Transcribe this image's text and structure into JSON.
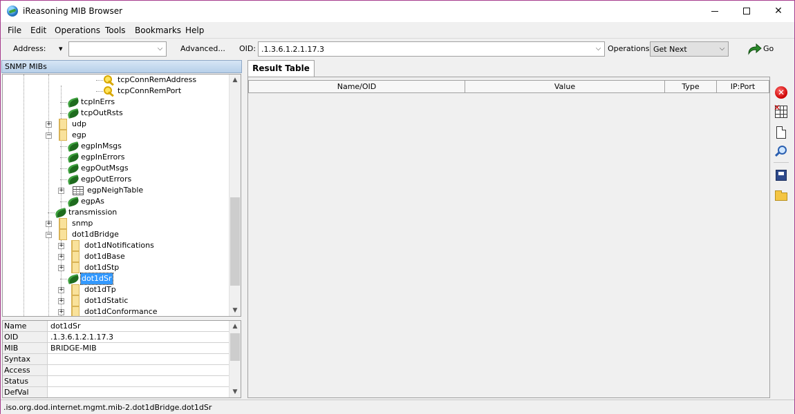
{
  "window": {
    "title": "iReasoning MIB Browser"
  },
  "menu": [
    "File",
    "Edit",
    "Operations",
    "Tools",
    "Bookmarks",
    "Help"
  ],
  "toolbar": {
    "address_label": "Address:",
    "address_value": "",
    "advanced_label": "Advanced...",
    "oid_label": "OID:",
    "oid_value": ".1.3.6.1.2.1.17.3",
    "operations_label": "Operations:",
    "operations_value": "Get Next",
    "go_label": "Go"
  },
  "tree": {
    "header": "SNMP MIBs",
    "items": [
      {
        "label": "tcpConnRemAddress",
        "icon": "key-icon",
        "depth": 4,
        "expander": false
      },
      {
        "label": "tcpConnRemPort",
        "icon": "key-icon",
        "depth": 4,
        "expander": false
      },
      {
        "label": "tcpInErrs",
        "icon": "leaf-icon",
        "depth": 2,
        "expander": false
      },
      {
        "label": "tcpOutRsts",
        "icon": "leaf-icon",
        "depth": 2,
        "expander": false
      },
      {
        "label": "udp",
        "icon": "folder-icon",
        "depth": 1,
        "expander": "plus"
      },
      {
        "label": "egp",
        "icon": "folder-icon",
        "depth": 1,
        "expander": "minus"
      },
      {
        "label": "egpInMsgs",
        "icon": "leaf-icon",
        "depth": 2,
        "expander": false
      },
      {
        "label": "egpInErrors",
        "icon": "leaf-icon",
        "depth": 2,
        "expander": false
      },
      {
        "label": "egpOutMsgs",
        "icon": "leaf-icon",
        "depth": 2,
        "expander": false
      },
      {
        "label": "egpOutErrors",
        "icon": "leaf-icon",
        "depth": 2,
        "expander": false
      },
      {
        "label": "egpNeighTable",
        "icon": "table-icon",
        "depth": 2,
        "expander": "plus"
      },
      {
        "label": "egpAs",
        "icon": "leaf-icon",
        "depth": 2,
        "expander": false
      },
      {
        "label": "transmission",
        "icon": "leaf-icon",
        "depth": 1,
        "expander": false
      },
      {
        "label": "snmp",
        "icon": "folder-icon",
        "depth": 1,
        "expander": "plus"
      },
      {
        "label": "dot1dBridge",
        "icon": "folder-icon",
        "depth": 1,
        "expander": "minus"
      },
      {
        "label": "dot1dNotifications",
        "icon": "folder-icon",
        "depth": 2,
        "expander": "plus"
      },
      {
        "label": "dot1dBase",
        "icon": "folder-icon",
        "depth": 2,
        "expander": "plus"
      },
      {
        "label": "dot1dStp",
        "icon": "folder-icon",
        "depth": 2,
        "expander": "plus"
      },
      {
        "label": "dot1dSr",
        "icon": "leaf-icon",
        "depth": 2,
        "expander": false,
        "selected": true
      },
      {
        "label": "dot1dTp",
        "icon": "folder-icon",
        "depth": 2,
        "expander": "plus"
      },
      {
        "label": "dot1dStatic",
        "icon": "folder-icon",
        "depth": 2,
        "expander": "plus"
      },
      {
        "label": "dot1dConformance",
        "icon": "folder-icon",
        "depth": 2,
        "expander": "plus"
      }
    ]
  },
  "properties": [
    {
      "key": "Name",
      "value": "dot1dSr"
    },
    {
      "key": "OID",
      "value": ".1.3.6.1.2.1.17.3"
    },
    {
      "key": "MIB",
      "value": "BRIDGE-MIB"
    },
    {
      "key": "Syntax",
      "value": ""
    },
    {
      "key": "Access",
      "value": ""
    },
    {
      "key": "Status",
      "value": ""
    },
    {
      "key": "DefVal",
      "value": ""
    }
  ],
  "result": {
    "tab_label": "Result Table",
    "columns": [
      "Name/OID",
      "Value",
      "Type",
      "IP:Port"
    ]
  },
  "status_bar": {
    "text": ".iso.org.dod.internet.mgmt.mib-2.dot1dBridge.dot1dSr"
  },
  "colors": {
    "selection": "#3399ff",
    "window_border": "#a53a8c",
    "folder": "#f9e29b",
    "leaf": "#1e6b1e"
  }
}
